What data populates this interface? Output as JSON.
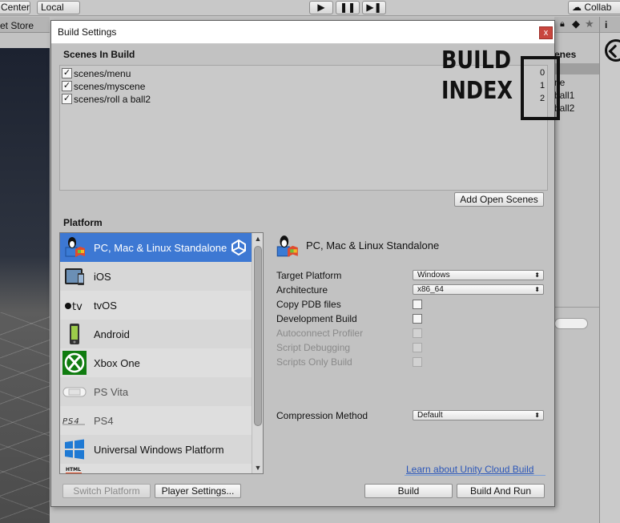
{
  "editor": {
    "toolbar": {
      "center": "Center",
      "local": "Local",
      "collab": "Collab",
      "play": "▶",
      "pause": "❚❚",
      "step": "▶❚"
    },
    "asset_store_tab": "et Store",
    "right_panel": {
      "header": "enes",
      "items": [
        "ne",
        "ball1",
        "ball2"
      ]
    }
  },
  "dialog": {
    "title": "Build Settings",
    "close": "x",
    "scenes_in_build": {
      "heading": "Scenes In Build",
      "scenes": [
        {
          "name": "scenes/menu",
          "checked": true,
          "index": "0"
        },
        {
          "name": "scenes/myscene",
          "checked": true,
          "index": "1"
        },
        {
          "name": "scenes/roll a ball2",
          "checked": true,
          "index": "2"
        }
      ],
      "add_open_scenes": "Add Open Scenes"
    },
    "annotation": {
      "line1": "BUILD",
      "line2": "INDEX"
    },
    "platform": {
      "heading": "Platform",
      "items": [
        {
          "label": "PC, Mac & Linux Standalone",
          "icon": "pc-mac-linux-icon",
          "selected": true
        },
        {
          "label": "iOS",
          "icon": "ios-icon"
        },
        {
          "label": "tvOS",
          "icon": "tvos-icon"
        },
        {
          "label": "Android",
          "icon": "android-icon"
        },
        {
          "label": "Xbox One",
          "icon": "xbox-icon"
        },
        {
          "label": "PS Vita",
          "icon": "ps-vita-icon"
        },
        {
          "label": "PS4",
          "icon": "ps4-icon"
        },
        {
          "label": "Universal Windows Platform",
          "icon": "windows-icon"
        },
        {
          "label": "",
          "icon": "html5-icon"
        }
      ]
    },
    "settings": {
      "title": "PC, Mac & Linux Standalone",
      "target_platform": {
        "label": "Target Platform",
        "value": "Windows"
      },
      "architecture": {
        "label": "Architecture",
        "value": "x86_64"
      },
      "copy_pdb": {
        "label": "Copy PDB files",
        "checked": false
      },
      "development_build": {
        "label": "Development Build",
        "checked": false
      },
      "autoconnect_profiler": {
        "label": "Autoconnect Profiler",
        "checked": false,
        "enabled": false
      },
      "script_debugging": {
        "label": "Script Debugging",
        "checked": false,
        "enabled": false
      },
      "scripts_only_build": {
        "label": "Scripts Only Build",
        "checked": false,
        "enabled": false
      },
      "compression": {
        "label": "Compression Method",
        "value": "Default"
      },
      "cloud_link": "Learn about Unity Cloud Build"
    },
    "buttons": {
      "switch_platform": "Switch Platform",
      "player_settings": "Player Settings...",
      "build": "Build",
      "build_and_run": "Build And Run"
    },
    "colors": {
      "selection": "#3d78d3",
      "link": "#2b56b8",
      "close": "#c8463e",
      "annotation": "#111111"
    }
  }
}
